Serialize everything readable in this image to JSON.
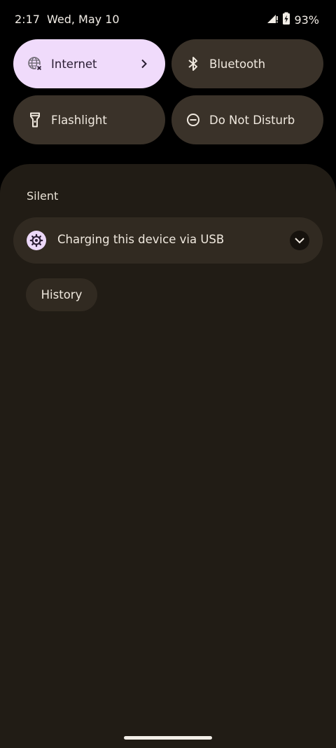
{
  "status_bar": {
    "time": "2:17",
    "date": "Wed, May 10",
    "battery_percent": "93%",
    "icons": [
      "signal-icon",
      "battery-charging-icon"
    ]
  },
  "quick_settings": {
    "tiles": [
      {
        "label": "Internet",
        "icon": "globe-off-icon",
        "active": true,
        "has_chevron": true
      },
      {
        "label": "Bluetooth",
        "icon": "bluetooth-icon",
        "active": false
      },
      {
        "label": "Flashlight",
        "icon": "flashlight-icon",
        "active": false
      },
      {
        "label": "Do Not Disturb",
        "icon": "do-not-disturb-icon",
        "active": false
      }
    ]
  },
  "notifications": {
    "section_title": "Silent",
    "items": [
      {
        "title": "Charging this device via USB",
        "icon": "usb-settings-icon"
      }
    ],
    "history_label": "History"
  },
  "colors": {
    "tile_active": "#f0dbfb",
    "tile_inactive": "#3a3229",
    "shade_background": "#211c15",
    "notification_background": "#312a21"
  }
}
